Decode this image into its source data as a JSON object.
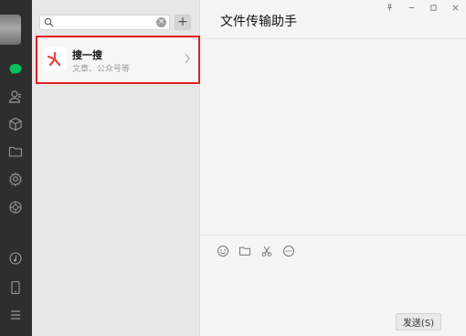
{
  "search": {
    "placeholder": "",
    "clear_glyph": "×"
  },
  "add_button": {
    "label": "+"
  },
  "sos_card": {
    "title": "搜一搜",
    "subtitle": "文章、公众号等"
  },
  "chat": {
    "title": "文件传输助手",
    "send_label": "发送(S)"
  },
  "icons": {
    "nav": [
      "chat-icon",
      "contacts-icon",
      "box-icon",
      "folder-icon",
      "settings-icon",
      "moments-icon",
      "music-icon",
      "phone-icon",
      "menu-icon"
    ],
    "toolbar": [
      "emoji-icon",
      "folder-icon",
      "scissors-icon",
      "chat-bubble-icon"
    ],
    "titlebar": [
      "pin-icon",
      "minimize-icon",
      "maximize-icon",
      "close-icon"
    ]
  },
  "colors": {
    "accent": "#07c160",
    "highlight_border": "#e02020",
    "nav_bg": "#2e2e2e",
    "list_bg": "#e7e7e7"
  }
}
